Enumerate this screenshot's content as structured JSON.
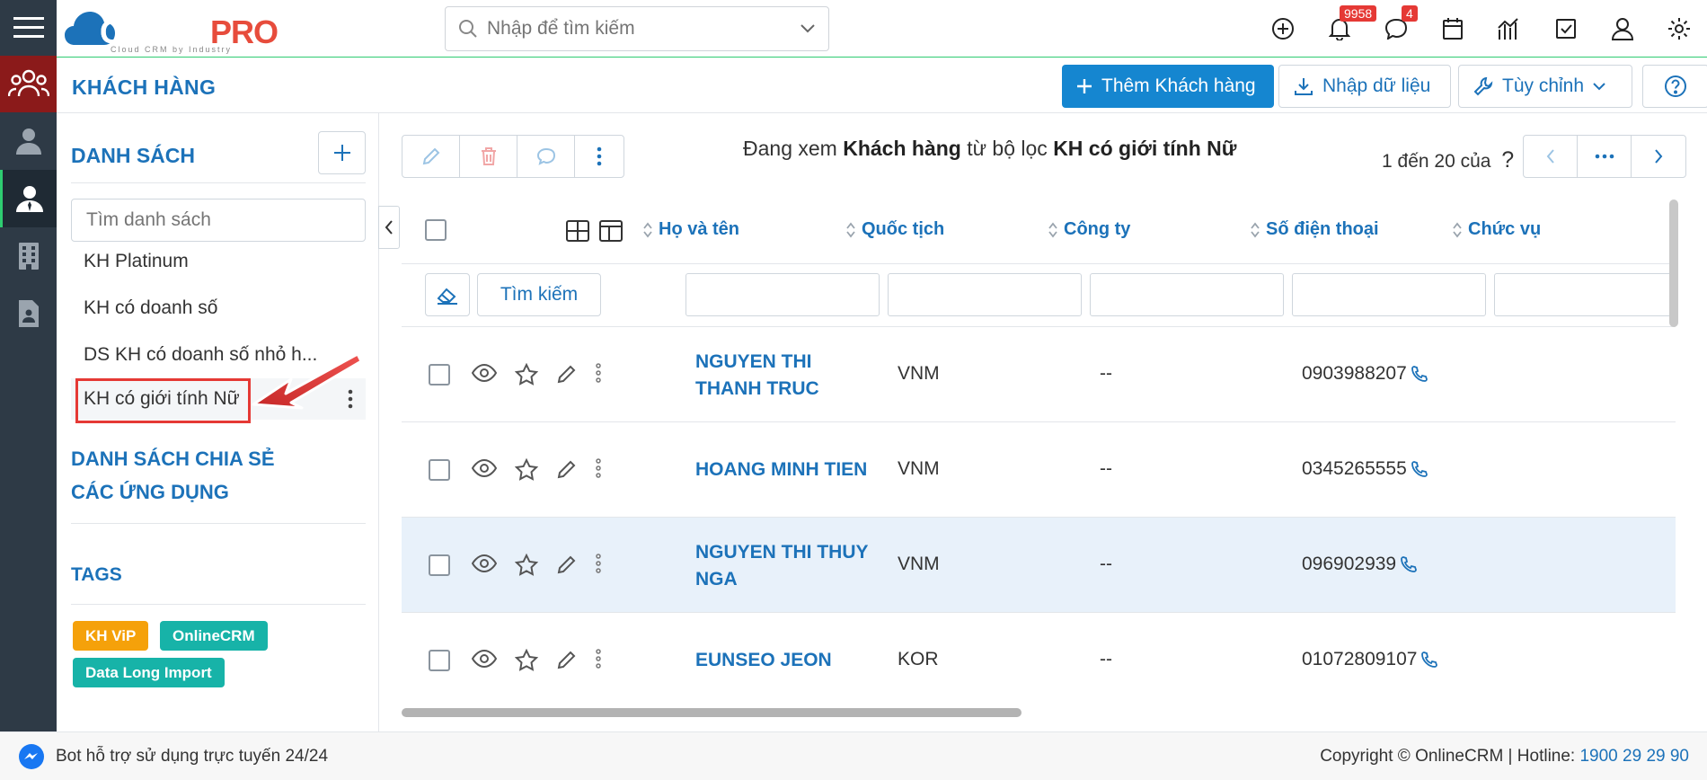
{
  "app": {
    "logo_main": "CLOUD",
    "logo_accent": "PRO",
    "logo_tagline": "Cloud CRM by Industry"
  },
  "search": {
    "placeholder": "Nhập để tìm kiếm"
  },
  "notifications": {
    "bell_count": "9958",
    "chat_count": "4"
  },
  "page": {
    "title": "KHÁCH HÀNG",
    "add_button": "Thêm Khách hàng",
    "import_button": "Nhập dữ liệu",
    "customize_button": "Tùy chỉnh"
  },
  "sidebar": {
    "list_title": "DANH SÁCH",
    "search_placeholder": "Tìm danh sách",
    "items": [
      {
        "label": "KH Platinum"
      },
      {
        "label": "KH có doanh số"
      },
      {
        "label": "DS KH có doanh số nhỏ h..."
      },
      {
        "label": "KH có giới tính Nữ"
      }
    ],
    "shared_title": "DANH SÁCH CHIA SẺ",
    "apps_title": "CÁC ỨNG DỤNG",
    "tags_title": "TAGS",
    "tags": [
      {
        "label": "KH ViP",
        "color": "#f5a10a"
      },
      {
        "label": "OnlineCRM",
        "color": "#17b3a8"
      },
      {
        "label": "Data Long Import",
        "color": "#17b3a8"
      }
    ]
  },
  "main": {
    "caption_prefix": "Đang xem ",
    "caption_module": "Khách hàng",
    "caption_middle": " từ bộ lọc ",
    "caption_filter": "KH có giới tính Nữ",
    "pager_info": "1 đến 20 của",
    "pager_unknown": "?",
    "search_button": "Tìm kiếm",
    "columns": [
      "Họ và tên",
      "Quốc tịch",
      "Công ty",
      "Số điện thoại",
      "Chức vụ"
    ],
    "rows": [
      {
        "name": "NGUYEN THI THANH TRUC",
        "nationality": "VNM",
        "company": "--",
        "phone": "0903988207"
      },
      {
        "name": "HOANG MINH TIEN",
        "nationality": "VNM",
        "company": "--",
        "phone": "0345265555"
      },
      {
        "name": "NGUYEN THI THUY NGA",
        "nationality": "VNM",
        "company": "--",
        "phone": "096902939"
      },
      {
        "name": "EUNSEO JEON",
        "nationality": "KOR",
        "company": "--",
        "phone": "01072809107"
      }
    ]
  },
  "footer": {
    "bot_text": "Bot hỗ trợ sử dụng trực tuyến 24/24",
    "copyright": "Copyright © OnlineCRM",
    "hotline_label": "Hotline:",
    "hotline": "1900 29 29 90"
  },
  "colors": {
    "accent": "#1c72b9",
    "primary_button": "#1586d0",
    "rail": "#2e3a46",
    "rail_active": "#8b1a1a"
  }
}
